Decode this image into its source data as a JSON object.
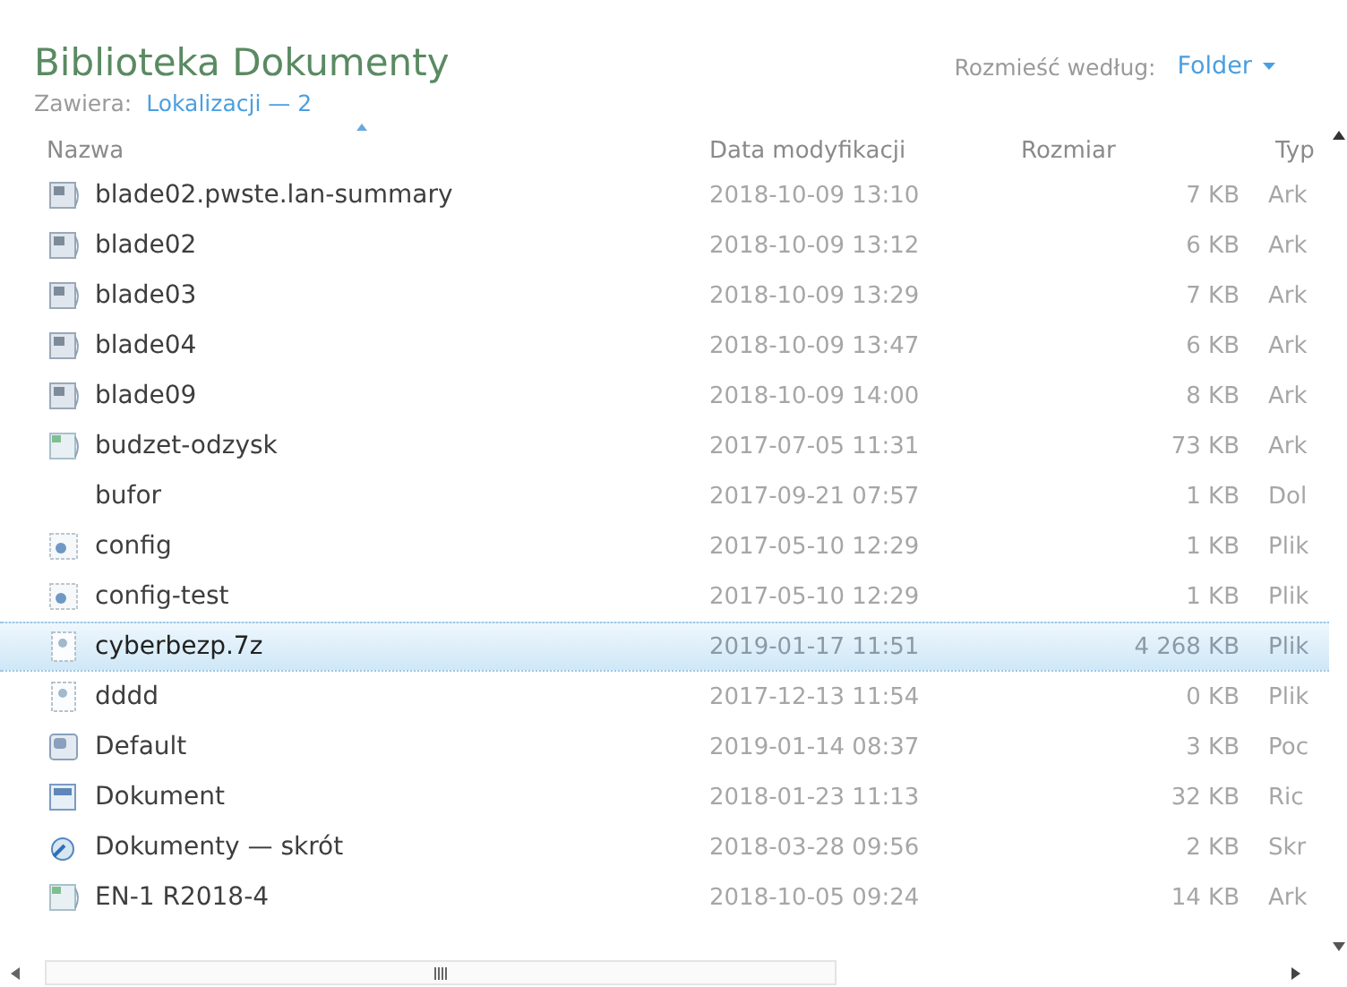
{
  "library": {
    "title": "Biblioteka Dokumenty",
    "includes_label": "Zawiera:",
    "includes_link": "Lokalizacji — 2",
    "arrange_label": "Rozmieść według:",
    "arrange_value": "Folder"
  },
  "table": {
    "columns": [
      "Nazwa",
      "Data modyfikacji",
      "Rozmiar",
      "Typ"
    ],
    "rows": [
      {
        "kind": "spreadsheet",
        "name": "blade02.pwste.lan-summary",
        "date": "2018-10-09 13:10",
        "size": "7 KB",
        "type": "Ark",
        "selected": false
      },
      {
        "kind": "spreadsheet",
        "name": "blade02",
        "date": "2018-10-09 13:12",
        "size": "6 KB",
        "type": "Ark",
        "selected": false
      },
      {
        "kind": "spreadsheet",
        "name": "blade03",
        "date": "2018-10-09 13:29",
        "size": "7 KB",
        "type": "Ark",
        "selected": false
      },
      {
        "kind": "spreadsheet",
        "name": "blade04",
        "date": "2018-10-09 13:47",
        "size": "6 KB",
        "type": "Ark",
        "selected": false
      },
      {
        "kind": "spreadsheet",
        "name": "blade09",
        "date": "2018-10-09 14:00",
        "size": "8 KB",
        "type": "Ark",
        "selected": false
      },
      {
        "kind": "sheet",
        "name": "budzet-odzysk",
        "date": "2017-07-05 11:31",
        "size": "73 KB",
        "type": "Ark",
        "selected": false
      },
      {
        "kind": "blank",
        "name": "bufor",
        "date": "2017-09-21 07:57",
        "size": "1 KB",
        "type": "Dol",
        "selected": false
      },
      {
        "kind": "config",
        "name": "config",
        "date": "2017-05-10 12:29",
        "size": "1 KB",
        "type": "Plik",
        "selected": false
      },
      {
        "kind": "config",
        "name": "config-test",
        "date": "2017-05-10 12:29",
        "size": "1 KB",
        "type": "Plik",
        "selected": false
      },
      {
        "kind": "file",
        "name": "cyberbezp.7z",
        "date": "2019-01-17 11:51",
        "size": "4 268 KB",
        "type": "Plik",
        "selected": true
      },
      {
        "kind": "file",
        "name": "dddd",
        "date": "2017-12-13 11:54",
        "size": "0 KB",
        "type": "Plik",
        "selected": false
      },
      {
        "kind": "profile",
        "name": "Default",
        "date": "2019-01-14 08:37",
        "size": "3 KB",
        "type": "Poc",
        "selected": false
      },
      {
        "kind": "document",
        "name": "Dokument",
        "date": "2018-01-23 11:13",
        "size": "32 KB",
        "type": "Ric",
        "selected": false
      },
      {
        "kind": "shortcut",
        "name": "Dokumenty — skrót",
        "date": "2018-03-28 09:56",
        "size": "2 KB",
        "type": "Skr",
        "selected": false
      },
      {
        "kind": "sheet",
        "name": "EN-1 R2018-4",
        "date": "2018-10-05 09:24",
        "size": "14 KB",
        "type": "Ark",
        "selected": false
      }
    ]
  }
}
